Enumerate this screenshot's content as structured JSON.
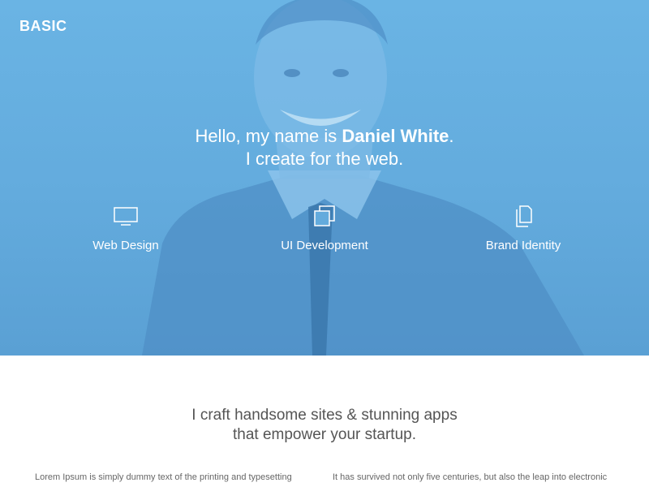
{
  "header": {
    "brand": "BASIC"
  },
  "hero": {
    "greeting_prefix": "Hello, my name is",
    "name": "Daniel White",
    "greeting_suffix": ".",
    "subline": "I create for the web.",
    "overlay_color": "#63abdd"
  },
  "services": [
    {
      "icon": "monitor-icon",
      "label": "Web Design"
    },
    {
      "icon": "stacked-squares-icon",
      "label": "UI Development"
    },
    {
      "icon": "documents-icon",
      "label": "Brand Identity"
    }
  ],
  "intro": {
    "line1": "I craft handsome sites & stunning apps",
    "line2": "that empower your startup."
  },
  "columns": [
    "Lorem Ipsum is simply dummy text of the printing and typesetting",
    "It has survived not only five centuries, but also the leap into electronic"
  ]
}
